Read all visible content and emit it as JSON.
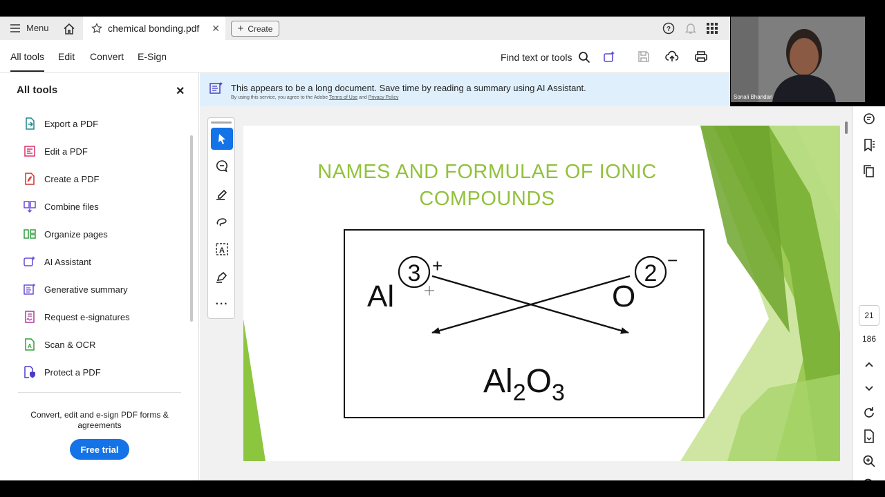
{
  "topbar": {
    "menu_label": "Menu",
    "tab_title": "chemical bonding.pdf",
    "create_label": "Create"
  },
  "toolbar": {
    "tabs": [
      "All tools",
      "Edit",
      "Convert",
      "E-Sign"
    ],
    "find_label": "Find text or tools"
  },
  "sidebar": {
    "title": "All tools",
    "items": [
      {
        "label": "Export a PDF",
        "icon": "export-pdf-icon",
        "color": "#1a8a8a"
      },
      {
        "label": "Edit a PDF",
        "icon": "edit-pdf-icon",
        "color": "#d6336c"
      },
      {
        "label": "Create a PDF",
        "icon": "create-pdf-icon",
        "color": "#d32f2f"
      },
      {
        "label": "Combine files",
        "icon": "combine-files-icon",
        "color": "#6a4cd6"
      },
      {
        "label": "Organize pages",
        "icon": "organize-pages-icon",
        "color": "#2e9e3e"
      },
      {
        "label": "AI Assistant",
        "icon": "ai-assistant-icon",
        "color": "#6a4cd6"
      },
      {
        "label": "Generative summary",
        "icon": "generative-summary-icon",
        "color": "#6a4cd6"
      },
      {
        "label": "Request e-signatures",
        "icon": "request-esign-icon",
        "color": "#b0379f"
      },
      {
        "label": "Scan & OCR",
        "icon": "scan-ocr-icon",
        "color": "#2e9e3e"
      },
      {
        "label": "Protect a PDF",
        "icon": "protect-pdf-icon",
        "color": "#4a3cc6"
      }
    ],
    "promo_text": "Convert, edit and e-sign PDF forms & agreements",
    "trial_label": "Free trial"
  },
  "banner": {
    "message": "This appears to be a long document. Save time by reading a summary using AI Assistant.",
    "sub_prefix": "By using this service, you agree to the Adobe",
    "terms_link": "Terms of Use",
    "and": "and",
    "privacy_link": "Privacy Policy"
  },
  "slide": {
    "title_line1": "NAMES AND FORMULAE  OF IONIC",
    "title_line2": "COMPOUNDS",
    "cation": "Al",
    "cation_charge": "3",
    "cation_sign": "+",
    "anion": "O",
    "anion_charge": "2",
    "anion_sign": "−",
    "formula_el1": "Al",
    "formula_sub1": "2",
    "formula_el2": "O",
    "formula_sub2": "3"
  },
  "pager": {
    "current_page": "21",
    "total_pages": "186"
  },
  "webcam": {
    "participant_name": "Sonali Bhandari"
  },
  "colors": {
    "accent": "#1473e6",
    "slide_green": "#92c13c",
    "banner_bg": "#dff0fc"
  }
}
